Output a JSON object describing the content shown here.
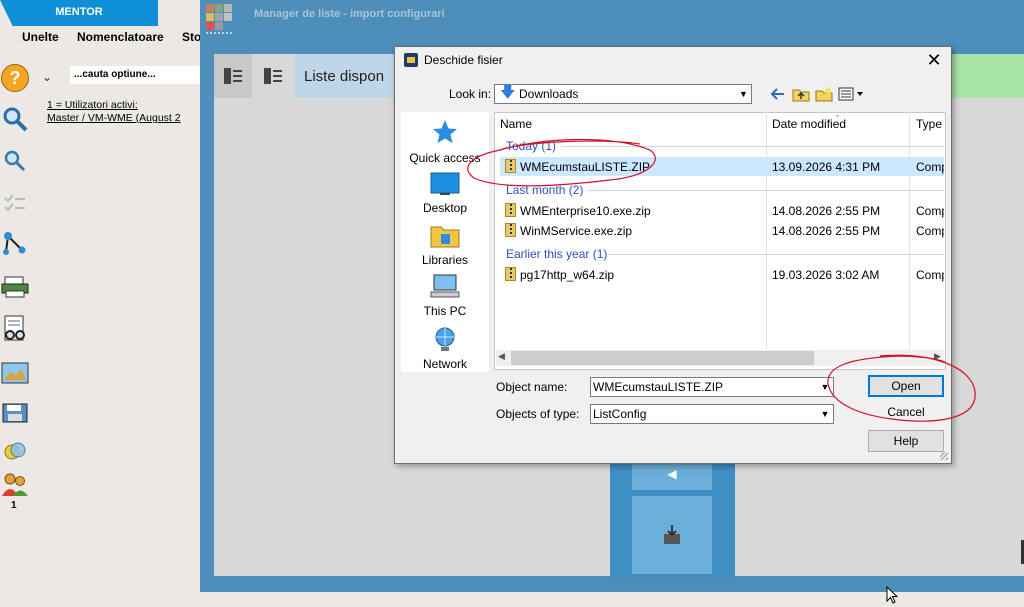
{
  "mentor": {
    "brand": "MENTOR",
    "menu": [
      "Unelte",
      "Nomenclatoare",
      "Sto"
    ],
    "search_placeholder": "...cauta optiune...",
    "user_line1": "1 = Utilizatori activi:",
    "user_line2": "Master   / VM-WME  (August  2",
    "user_count": "1"
  },
  "main": {
    "title": "Manager de liste  - import configurari",
    "list_title": "Liste dispon"
  },
  "dialog": {
    "title": "Deschide fisier",
    "close": "✕",
    "look_in_label": "Look in:",
    "look_in_value": "Downloads",
    "places": [
      "Quick access",
      "Desktop",
      "Libraries",
      "This PC",
      "Network"
    ],
    "columns": [
      "Name",
      "Date modified",
      "Type"
    ],
    "groups": [
      {
        "label": "Today (1)",
        "files": [
          {
            "name": "WMEcumstauLISTE.ZIP",
            "date": "13.09.2026 4:31 PM",
            "type": "Comp",
            "selected": true
          }
        ]
      },
      {
        "label": "Last month (2)",
        "files": [
          {
            "name": "WMEnterprise10.exe.zip",
            "date": "14.08.2026 2:55 PM",
            "type": "Comp"
          },
          {
            "name": "WinMService.exe.zip",
            "date": "14.08.2026 2:55 PM",
            "type": "Comp"
          }
        ]
      },
      {
        "label": "Earlier this year (1)",
        "files": [
          {
            "name": "pg17http_w64.zip",
            "date": "19.03.2026 3:02 AM",
            "type": "Comp"
          }
        ]
      }
    ],
    "object_name_label": "Object name:",
    "object_name_value": "WMEcumstauLISTE.ZIP",
    "objects_type_label": "Objects of type:",
    "objects_type_value": "ListConfig",
    "open_button": "Open",
    "cancel_button": "Cancel",
    "help_button": "Help"
  },
  "colors": {
    "accent": "#0e8fd6",
    "window_bg": "#4d8fb8",
    "annotation": "#d0102a",
    "selection": "#cce8ff"
  }
}
